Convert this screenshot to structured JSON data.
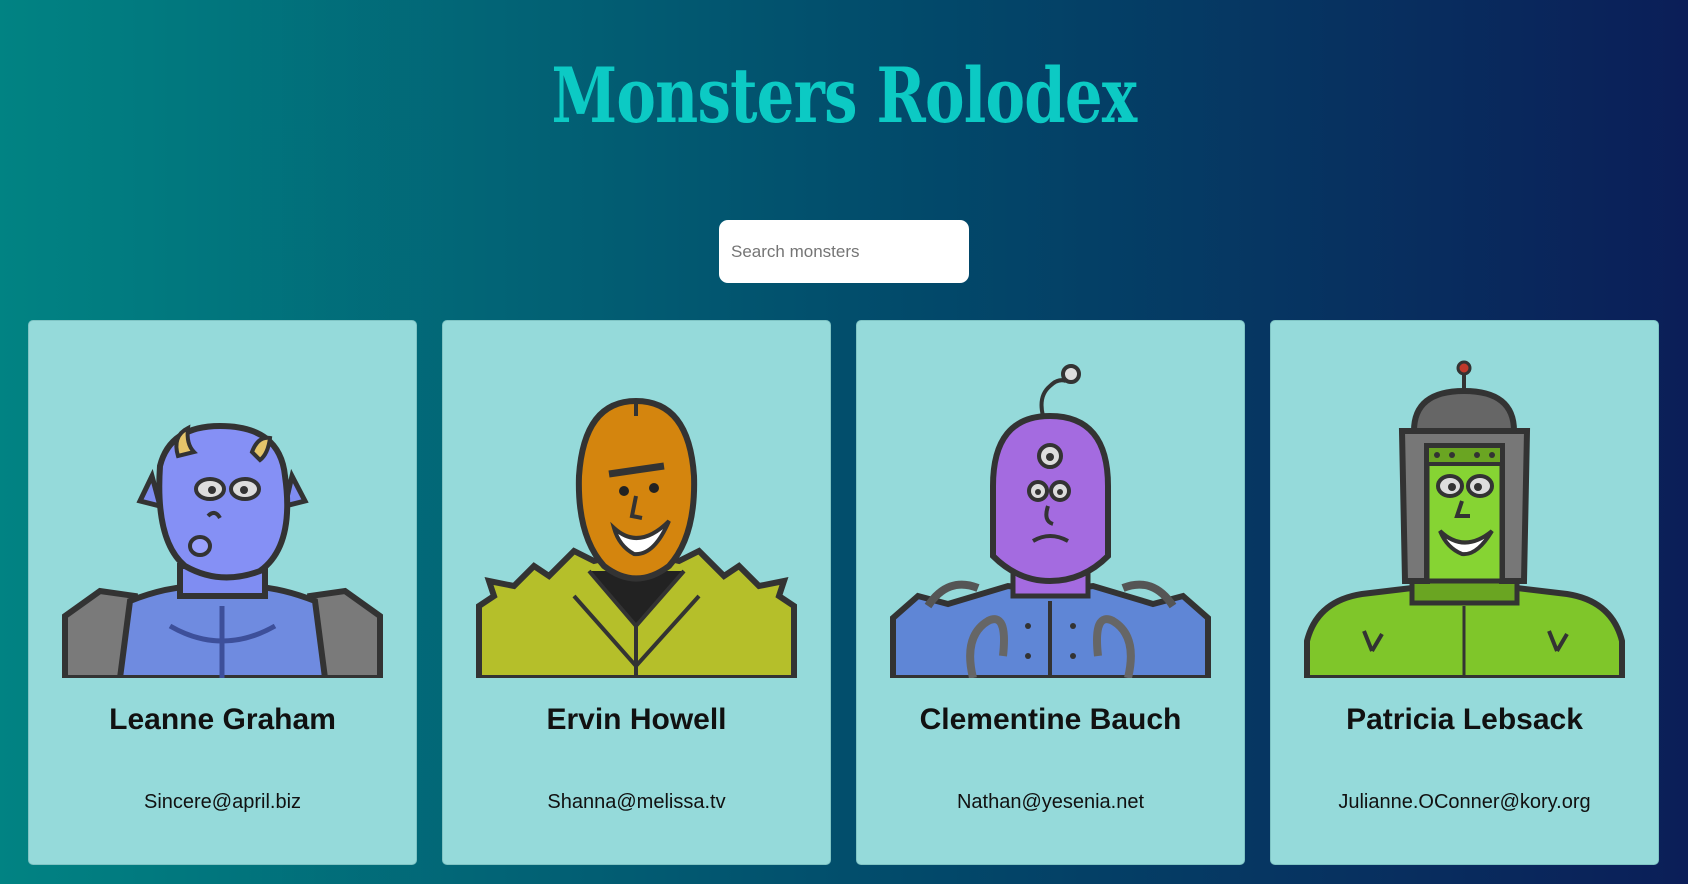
{
  "app": {
    "title": "Monsters Rolodex"
  },
  "search": {
    "placeholder": "Search monsters",
    "value": ""
  },
  "monsters": [
    {
      "name": "Leanne Graham",
      "email": "Sincere@april.biz",
      "avatar": "blue-horned-monster"
    },
    {
      "name": "Ervin Howell",
      "email": "Shanna@melissa.tv",
      "avatar": "orange-spiky-monster"
    },
    {
      "name": "Clementine Bauch",
      "email": "Nathan@yesenia.net",
      "avatar": "purple-three-eyed-robot-monster"
    },
    {
      "name": "Patricia Lebsack",
      "email": "Julianne.OConner@kory.org",
      "avatar": "green-helmet-robot-monster"
    }
  ]
}
